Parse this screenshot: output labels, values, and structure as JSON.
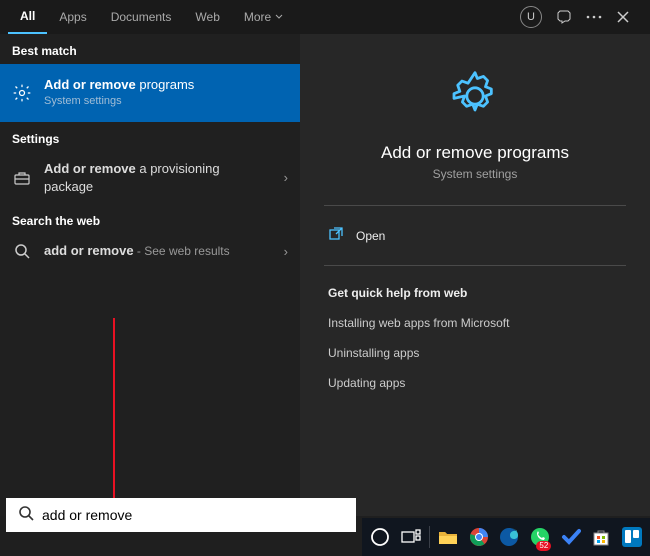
{
  "tabs": {
    "all": "All",
    "apps": "Apps",
    "documents": "Documents",
    "web": "Web",
    "more": "More"
  },
  "avatar": "U",
  "sections": {
    "best": "Best match",
    "settings": "Settings",
    "web": "Search the web"
  },
  "best": {
    "title_bold": "Add or remove",
    "title_rest": " programs",
    "sub": "System settings"
  },
  "setting_item": {
    "title_bold": "Add or remove",
    "title_rest": " a provisioning package"
  },
  "web_item": {
    "title_bold": "add or remove",
    "suffix": " - See web results"
  },
  "detail": {
    "title": "Add or remove programs",
    "sub": "System settings",
    "open": "Open",
    "quick_help": "Get quick help from web",
    "links": [
      "Installing web apps from Microsoft",
      "Uninstalling apps",
      "Updating apps"
    ]
  },
  "search": {
    "value": "add or remove"
  },
  "whatsapp_badge": "52"
}
